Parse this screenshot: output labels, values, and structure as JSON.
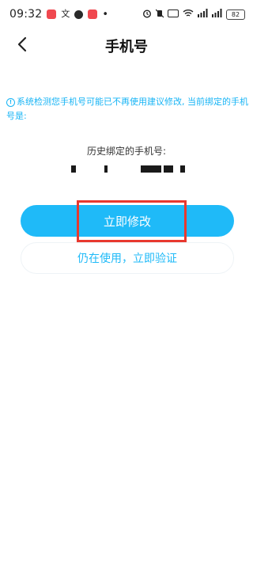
{
  "status_bar": {
    "time": "09:32",
    "notif_text": "文",
    "battery": "82"
  },
  "header": {
    "title": "手机号"
  },
  "notice": {
    "text": "系统检测您手机号可能已不再使用建议修改, 当前绑定的手机号是:"
  },
  "history": {
    "label": "历史绑定的手机号:"
  },
  "actions": {
    "modify_label": "立即修改",
    "verify_label": "仍在使用，立即验证"
  },
  "colors": {
    "accent": "#1fbaf8",
    "highlight": "#e8392f"
  },
  "icons": [
    "chevron-left-icon",
    "info-icon",
    "wifi-icon",
    "signal-icon",
    "battery-icon",
    "alarm-icon"
  ]
}
